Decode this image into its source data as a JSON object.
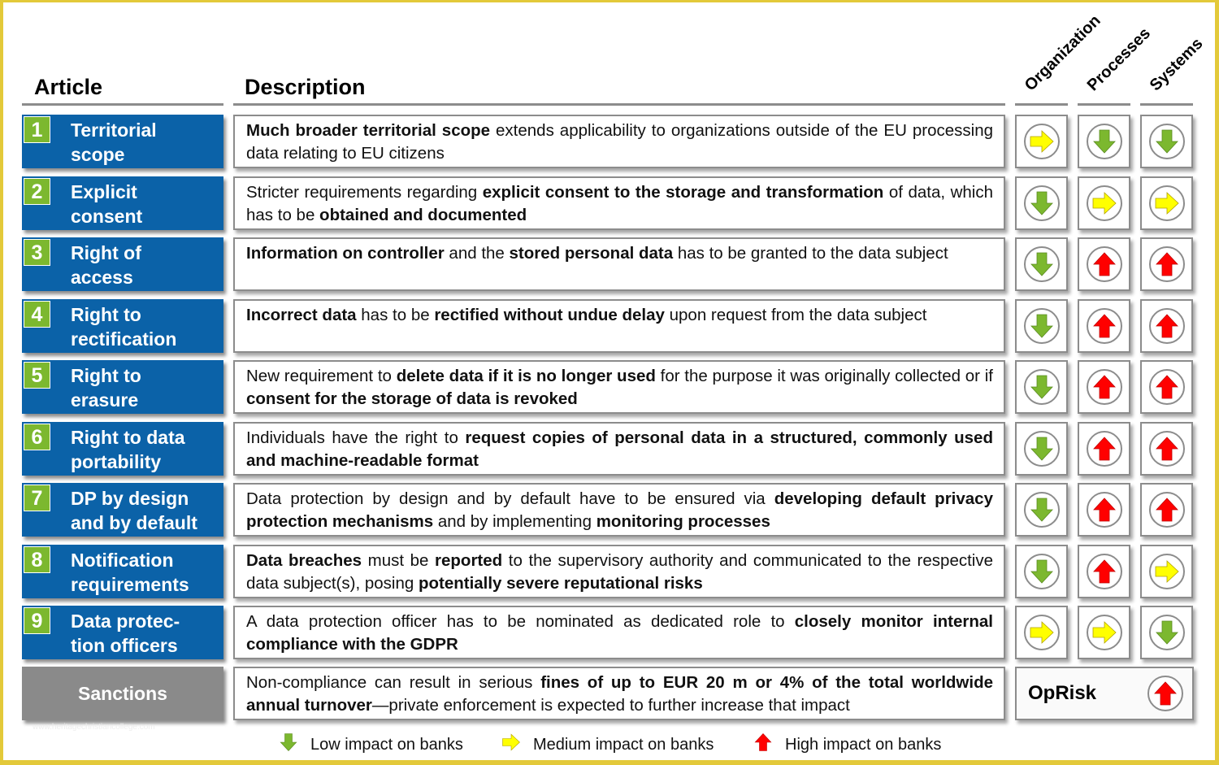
{
  "headers": {
    "article": "Article",
    "description": "Description",
    "columns": [
      "Organization",
      "Processes",
      "Systems"
    ]
  },
  "impact_levels": {
    "low": {
      "icon": "down-arrow-icon",
      "color": "#7cb82f"
    },
    "medium": {
      "icon": "right-arrow-icon",
      "color": "#ffff00"
    },
    "high": {
      "icon": "up-arrow-icon",
      "color": "#ff0000"
    }
  },
  "rows": [
    {
      "number": "1",
      "label_lines": [
        "Territorial",
        "scope"
      ],
      "description": [
        [
          "b",
          "Much broader territorial scope"
        ],
        [
          "t",
          " extends applicability to organizations outside of the EU processing data relating to EU citizens"
        ]
      ],
      "impacts": [
        "medium",
        "low",
        "low"
      ]
    },
    {
      "number": "2",
      "label_lines": [
        "Explicit",
        "consent"
      ],
      "description": [
        [
          "t",
          "Stricter requirements regarding "
        ],
        [
          "b",
          "explicit consent to the storage and transformation"
        ],
        [
          "t",
          " of data, which has to be "
        ],
        [
          "b",
          "obtained and documented"
        ]
      ],
      "impacts": [
        "low",
        "medium",
        "medium"
      ]
    },
    {
      "number": "3",
      "label_lines": [
        "Right of",
        "access"
      ],
      "description": [
        [
          "b",
          "Information on controller"
        ],
        [
          "t",
          " and the "
        ],
        [
          "b",
          "stored personal data"
        ],
        [
          "t",
          " has to be granted to the data subject"
        ]
      ],
      "impacts": [
        "low",
        "high",
        "high"
      ]
    },
    {
      "number": "4",
      "label_lines": [
        "Right to",
        "rectification"
      ],
      "description": [
        [
          "b",
          "Incorrect data"
        ],
        [
          "t",
          " has to be "
        ],
        [
          "b",
          "rectified without undue delay"
        ],
        [
          "t",
          " upon request from the data subject"
        ]
      ],
      "impacts": [
        "low",
        "high",
        "high"
      ]
    },
    {
      "number": "5",
      "label_lines": [
        "Right to",
        "erasure"
      ],
      "description": [
        [
          "t",
          "New requirement to "
        ],
        [
          "b",
          "delete data if it is no longer used"
        ],
        [
          "t",
          " for the purpose it was originally collected or if "
        ],
        [
          "b",
          "consent for the storage of data is revoked"
        ]
      ],
      "impacts": [
        "low",
        "high",
        "high"
      ]
    },
    {
      "number": "6",
      "label_lines": [
        "Right to data",
        "portability"
      ],
      "description": [
        [
          "t",
          "Individuals have the right to "
        ],
        [
          "b",
          "request copies of personal data in a structured, commonly used and machine-readable format"
        ]
      ],
      "impacts": [
        "low",
        "high",
        "high"
      ]
    },
    {
      "number": "7",
      "label_lines": [
        "DP by design",
        "and by default"
      ],
      "description": [
        [
          "t",
          "Data protection by design and by default have to be ensured via "
        ],
        [
          "b",
          "developing default privacy protection mechanisms"
        ],
        [
          "t",
          " and by implementing "
        ],
        [
          "b",
          "monitoring processes"
        ]
      ],
      "impacts": [
        "low",
        "high",
        "high"
      ]
    },
    {
      "number": "8",
      "label_lines": [
        "Notification",
        "requirements"
      ],
      "description": [
        [
          "b",
          "Data breaches"
        ],
        [
          "t",
          " must be "
        ],
        [
          "b",
          "reported"
        ],
        [
          "t",
          " to the supervisory authority and communicated to the respective data subject(s), posing "
        ],
        [
          "b",
          "potentially severe reputational risks"
        ]
      ],
      "impacts": [
        "low",
        "high",
        "medium"
      ]
    },
    {
      "number": "9",
      "label_lines": [
        "Data protec-",
        "tion officers"
      ],
      "description": [
        [
          "t",
          "A data protection officer has to be nominated as dedicated role to "
        ],
        [
          "b",
          "closely monitor internal compliance with the GDPR"
        ]
      ],
      "impacts": [
        "medium",
        "medium",
        "low"
      ]
    }
  ],
  "sanctions": {
    "label": "Sanctions",
    "description": [
      [
        "t",
        "Non-compliance can result in serious "
      ],
      [
        "b",
        "fines of up to EUR 20 m or 4% of the total worldwide annual turnover"
      ],
      [
        "t",
        "—private enforcement is expected to further increase that impact"
      ]
    ],
    "oprisk_label": "OpRisk",
    "impact": "high"
  },
  "legend": [
    {
      "level": "low",
      "label": "Low impact on banks"
    },
    {
      "level": "medium",
      "label": "Medium impact on banks"
    },
    {
      "level": "high",
      "label": "High impact on banks"
    }
  ],
  "watermark": "www.heritagechristiancollege.com"
}
